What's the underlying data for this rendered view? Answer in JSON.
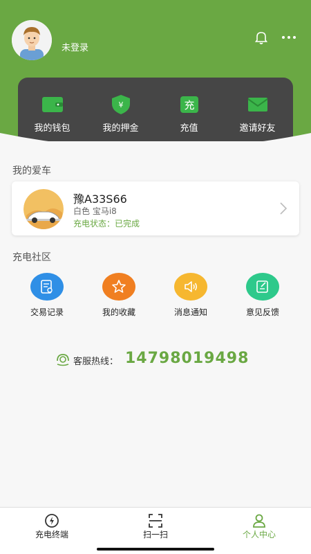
{
  "header": {
    "username": "未登录",
    "bell_icon": "bell-icon",
    "more_icon": "more-icon"
  },
  "wallet": {
    "items": [
      {
        "label": "我的钱包",
        "icon": "wallet-icon"
      },
      {
        "label": "我的押金",
        "icon": "deposit-shield-icon"
      },
      {
        "label": "充值",
        "icon": "recharge-icon",
        "glyph": "充"
      },
      {
        "label": "邀请好友",
        "icon": "envelope-icon"
      }
    ]
  },
  "my_car": {
    "title": "我的爱车",
    "plate": "豫A33S66",
    "model": "白色 宝马i8",
    "status": "充电状态：已完成"
  },
  "community": {
    "title": "充电社区",
    "items": [
      {
        "label": "交易记录",
        "icon": "record-icon",
        "color": "#2f8fe6"
      },
      {
        "label": "我的收藏",
        "icon": "star-icon",
        "color": "#f07f21"
      },
      {
        "label": "消息通知",
        "icon": "speaker-icon",
        "color": "#f6b730"
      },
      {
        "label": "意见反馈",
        "icon": "feedback-icon",
        "color": "#2ec98b"
      }
    ]
  },
  "hotline": {
    "label": "客服热线：",
    "number": "14798019498"
  },
  "nav": {
    "items": [
      {
        "label": "充电终端",
        "icon": "charging-terminal-icon",
        "active": false
      },
      {
        "label": "扫一扫",
        "icon": "scan-icon",
        "active": false
      },
      {
        "label": "个人中心",
        "icon": "user-center-icon",
        "active": true
      }
    ]
  },
  "colors": {
    "brand_green": "#6aa843",
    "panel_dark": "#464646"
  }
}
